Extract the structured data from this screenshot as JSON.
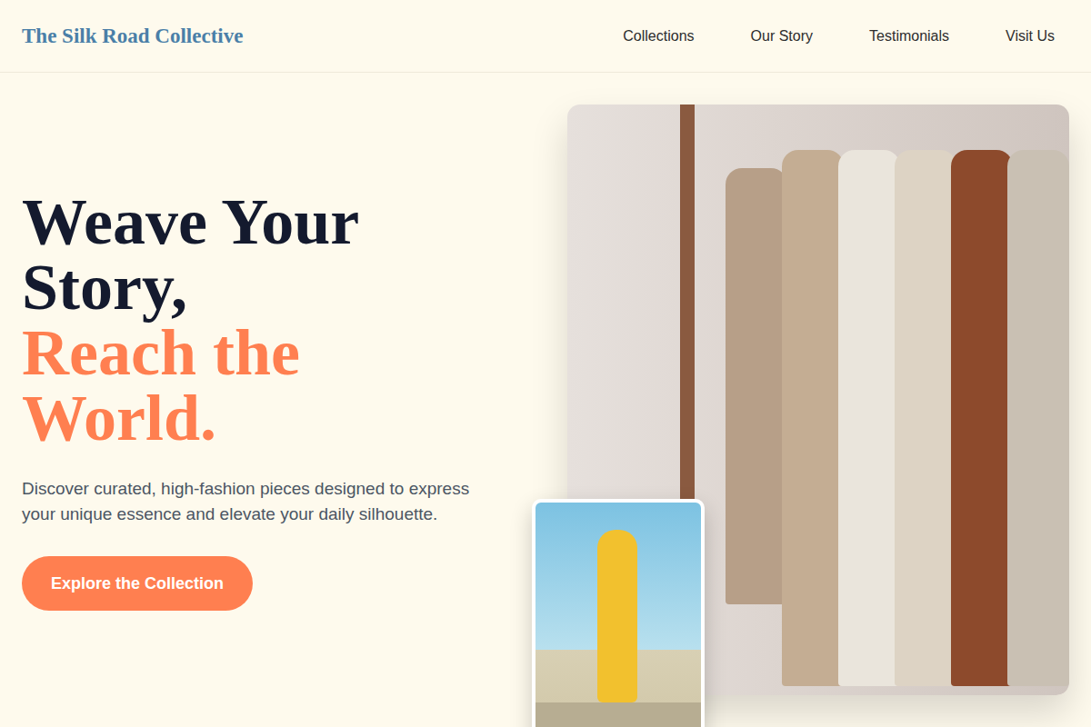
{
  "brand": "The Silk Road Collective",
  "nav": [
    {
      "label": "Collections"
    },
    {
      "label": "Our Story"
    },
    {
      "label": "Testimonials"
    },
    {
      "label": "Visit Us"
    }
  ],
  "hero": {
    "title_lines": [
      "Weave Your",
      "Story,"
    ],
    "accent_lines": [
      "Reach the",
      "World."
    ],
    "description": "Discover curated, high-fashion pieces designed to express your unique essence and elevate your daily silhouette.",
    "cta": "Explore the Collection"
  }
}
